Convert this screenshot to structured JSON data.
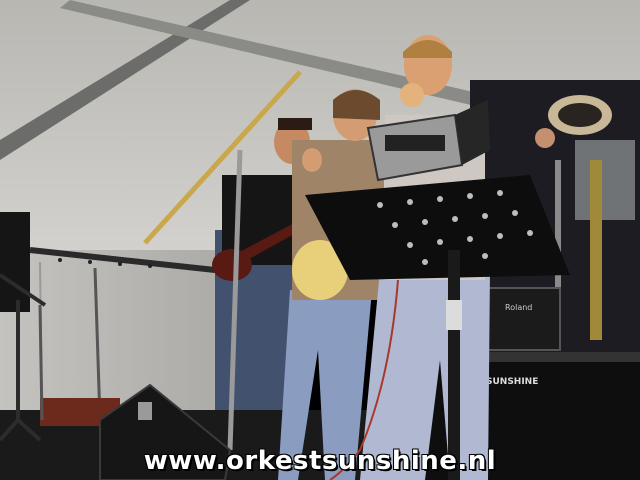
{
  "photo": {
    "watermark": "www.orkestsunshine.nl",
    "amp_brand": "Roland",
    "monitor_brand": "SUNSHINE",
    "description_colors": {
      "tent": "#c9c8c4",
      "tent_shadow": "#8f8e8a",
      "stage_dark": "#141414",
      "skin": "#d99a6a",
      "jeans": "#8a9cc0"
    }
  }
}
